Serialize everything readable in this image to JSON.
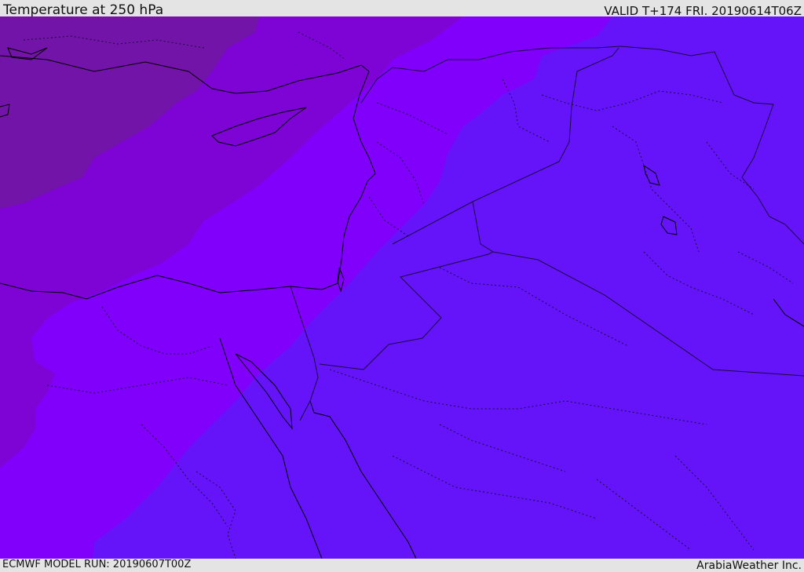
{
  "header": {
    "title": "Temperature at 250 hPa",
    "valid": "VALID T+174 FRI. 20190614T06Z"
  },
  "footer": {
    "model_run": "ECMWF MODEL RUN: 20190607T00Z",
    "credit": "ArabiaWeather Inc."
  },
  "map": {
    "field": "temperature",
    "level": "250 hPa",
    "colors": {
      "band_coldest": "#7214a8",
      "band_cold": "#7e04d6",
      "band_mid": "#8100fb",
      "band_warm": "#6514fa",
      "coastline": "#000000",
      "border": "#1a0a40"
    }
  }
}
